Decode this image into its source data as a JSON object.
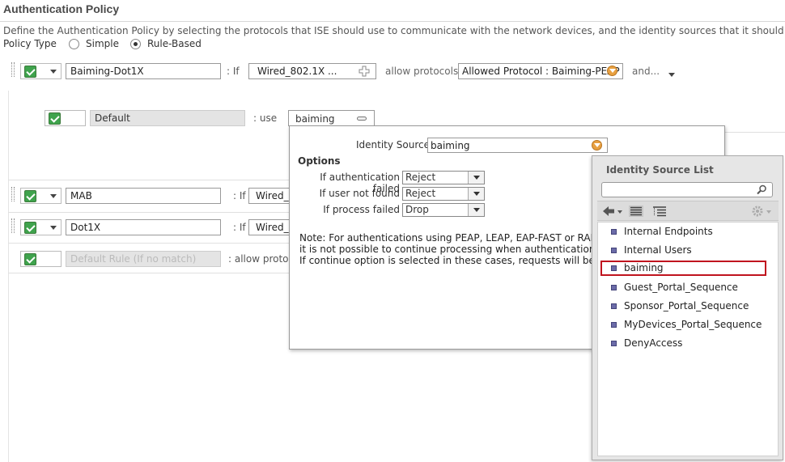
{
  "page": {
    "title": "Authentication Policy",
    "description": "Define the Authentication Policy by selecting the protocols that ISE should use to communicate with the network devices, and the identity sources that it should use for authe",
    "policy_type_label": "Policy Type",
    "policy_type_options": [
      "Simple",
      "Rule-Based"
    ],
    "policy_type_selected": "Rule-Based"
  },
  "rules": [
    {
      "name": "Baiming-Dot1X",
      "if_label": ": If",
      "condition": "Wired_802.1X ...",
      "allow_label": "allow protocols",
      "protocol": "Allowed Protocol : Baiming-PEAP",
      "and_label": "and..."
    },
    {
      "name": "MAB",
      "if_label": ": If",
      "condition": "Wired_"
    },
    {
      "name": "Dot1X",
      "if_label": ": If",
      "condition": "Wired_"
    },
    {
      "name": "Default Rule (If no match)",
      "allow_label": ": allow proto"
    }
  ],
  "default_subrule": {
    "name": "Default",
    "use_label": ":   use",
    "source_tab": "baiming"
  },
  "identity_popup": {
    "identity_source_label": "Identity Source",
    "identity_source_value": "baiming",
    "options_heading": "Options",
    "options": [
      {
        "label": "If authentication failed",
        "value": "Reject"
      },
      {
        "label": "If user not found",
        "value": "Reject"
      },
      {
        "label": "If process failed",
        "value": "Drop"
      }
    ],
    "note_lines": [
      "Note: For authentications using PEAP, LEAP, EAP-FAST or RADIUS",
      "it is not possible to continue processing when authentication fails o",
      "If continue option is selected in these cases, requests will be reject"
    ]
  },
  "source_list": {
    "title": "Identity Source List",
    "search_value": "",
    "items": [
      "Internal Endpoints",
      "Internal Users",
      "baiming",
      "Guest_Portal_Sequence",
      "Sponsor_Portal_Sequence",
      "MyDevices_Portal_Sequence",
      "DenyAccess"
    ],
    "selected": "baiming",
    "highlight_color": "#c0141e"
  }
}
